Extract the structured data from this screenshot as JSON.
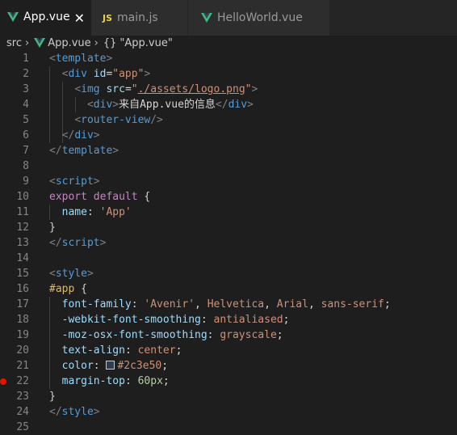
{
  "tabs": [
    {
      "label": "App.vue",
      "icon": "vue-icon",
      "active": true,
      "close": "✕"
    },
    {
      "label": "main.js",
      "icon": "js-icon",
      "icon_text": "JS",
      "active": false
    },
    {
      "label": "HelloWorld.vue",
      "icon": "vue-icon",
      "active": false
    }
  ],
  "breadcrumb": {
    "folder": "src",
    "file": "App.vue",
    "symbol_icon": "{}",
    "symbol": "\"App.vue\""
  },
  "colors": {
    "vue_green": "#41b883",
    "vue_dark": "#35495e",
    "breakpoint": "#e51400",
    "swatch": "#2c3e50"
  },
  "breakpoint_line": 22,
  "lines": [
    {
      "n": "1",
      "tokens": [
        [
          "t-punc",
          "<"
        ],
        [
          "t-tag",
          "template"
        ],
        [
          "t-punc",
          ">"
        ]
      ]
    },
    {
      "n": "2",
      "tokens": [
        [
          "t-text",
          "  "
        ],
        [
          "t-punc",
          "<"
        ],
        [
          "t-tag",
          "div"
        ],
        [
          "t-text",
          " "
        ],
        [
          "t-attr",
          "id"
        ],
        [
          "t-text",
          "="
        ],
        [
          "t-str",
          "\"app\""
        ],
        [
          "t-punc",
          ">"
        ]
      ]
    },
    {
      "n": "3",
      "tokens": [
        [
          "t-text",
          "    "
        ],
        [
          "t-punc",
          "<"
        ],
        [
          "t-tag",
          "img"
        ],
        [
          "t-text",
          " "
        ],
        [
          "t-attr",
          "src"
        ],
        [
          "t-text",
          "="
        ],
        [
          "t-str",
          "\""
        ],
        [
          "t-str u",
          "./assets/logo.png"
        ],
        [
          "t-str",
          "\""
        ],
        [
          "t-punc",
          ">"
        ]
      ]
    },
    {
      "n": "4",
      "tokens": [
        [
          "t-text",
          "      "
        ],
        [
          "t-punc",
          "<"
        ],
        [
          "t-tag",
          "div"
        ],
        [
          "t-punc",
          ">"
        ],
        [
          "t-text",
          "来自App.vue的信息"
        ],
        [
          "t-punc",
          "</"
        ],
        [
          "t-tag",
          "div"
        ],
        [
          "t-punc",
          ">"
        ]
      ]
    },
    {
      "n": "5",
      "tokens": [
        [
          "t-text",
          "    "
        ],
        [
          "t-punc",
          "<"
        ],
        [
          "t-tag",
          "router-view"
        ],
        [
          "t-punc",
          "/>"
        ]
      ]
    },
    {
      "n": "6",
      "tokens": [
        [
          "t-text",
          "  "
        ],
        [
          "t-punc",
          "</"
        ],
        [
          "t-tag",
          "div"
        ],
        [
          "t-punc",
          ">"
        ]
      ]
    },
    {
      "n": "7",
      "tokens": [
        [
          "t-punc",
          "</"
        ],
        [
          "t-tag",
          "template"
        ],
        [
          "t-punc",
          ">"
        ]
      ]
    },
    {
      "n": "8",
      "tokens": []
    },
    {
      "n": "9",
      "tokens": [
        [
          "t-punc",
          "<"
        ],
        [
          "t-tag",
          "script"
        ],
        [
          "t-punc",
          ">"
        ]
      ]
    },
    {
      "n": "10",
      "tokens": [
        [
          "t-kw",
          "export"
        ],
        [
          "t-text",
          " "
        ],
        [
          "t-kw",
          "default"
        ],
        [
          "t-text",
          " {"
        ]
      ]
    },
    {
      "n": "11",
      "tokens": [
        [
          "t-text",
          "  "
        ],
        [
          "t-prop",
          "name"
        ],
        [
          "t-text",
          ": "
        ],
        [
          "t-str",
          "'App'"
        ]
      ]
    },
    {
      "n": "12",
      "tokens": [
        [
          "t-text",
          "}"
        ]
      ]
    },
    {
      "n": "13",
      "tokens": [
        [
          "t-punc",
          "</"
        ],
        [
          "t-tag",
          "script"
        ],
        [
          "t-punc",
          ">"
        ]
      ]
    },
    {
      "n": "14",
      "tokens": []
    },
    {
      "n": "15",
      "tokens": [
        [
          "t-punc",
          "<"
        ],
        [
          "t-tag",
          "style"
        ],
        [
          "t-punc",
          ">"
        ]
      ]
    },
    {
      "n": "16",
      "tokens": [
        [
          "t-sel",
          "#app"
        ],
        [
          "t-text",
          " {"
        ]
      ]
    },
    {
      "n": "17",
      "tokens": [
        [
          "t-text",
          "  "
        ],
        [
          "t-prop",
          "font-family"
        ],
        [
          "t-text",
          ": "
        ],
        [
          "t-val",
          "'Avenir'"
        ],
        [
          "t-text",
          ", "
        ],
        [
          "t-val",
          "Helvetica"
        ],
        [
          "t-text",
          ", "
        ],
        [
          "t-val",
          "Arial"
        ],
        [
          "t-text",
          ", "
        ],
        [
          "t-val",
          "sans-serif"
        ],
        [
          "t-text",
          ";"
        ]
      ]
    },
    {
      "n": "18",
      "tokens": [
        [
          "t-text",
          "  "
        ],
        [
          "t-prop",
          "-webkit-font-smoothing"
        ],
        [
          "t-text",
          ": "
        ],
        [
          "t-val",
          "antialiased"
        ],
        [
          "t-text",
          ";"
        ]
      ]
    },
    {
      "n": "19",
      "tokens": [
        [
          "t-text",
          "  "
        ],
        [
          "t-prop",
          "-moz-osx-font-smoothing"
        ],
        [
          "t-text",
          ": "
        ],
        [
          "t-val",
          "grayscale"
        ],
        [
          "t-text",
          ";"
        ]
      ]
    },
    {
      "n": "20",
      "tokens": [
        [
          "t-text",
          "  "
        ],
        [
          "t-prop",
          "text-align"
        ],
        [
          "t-text",
          ": "
        ],
        [
          "t-val",
          "center"
        ],
        [
          "t-text",
          ";"
        ]
      ]
    },
    {
      "n": "21",
      "tokens": [
        [
          "t-text",
          "  "
        ],
        [
          "t-prop",
          "color"
        ],
        [
          "t-text",
          ": "
        ],
        [
          "swatch",
          ""
        ],
        [
          "t-val",
          "#2c3e50"
        ],
        [
          "t-text",
          ";"
        ]
      ]
    },
    {
      "n": "22",
      "tokens": [
        [
          "t-text",
          "  "
        ],
        [
          "t-prop",
          "margin-top"
        ],
        [
          "t-text",
          ": "
        ],
        [
          "t-num",
          "60px"
        ],
        [
          "t-text",
          ";"
        ]
      ]
    },
    {
      "n": "23",
      "tokens": [
        [
          "t-text",
          "}"
        ]
      ]
    },
    {
      "n": "24",
      "tokens": [
        [
          "t-punc",
          "</"
        ],
        [
          "t-tag",
          "style"
        ],
        [
          "t-punc",
          ">"
        ]
      ]
    },
    {
      "n": "25",
      "tokens": []
    }
  ]
}
